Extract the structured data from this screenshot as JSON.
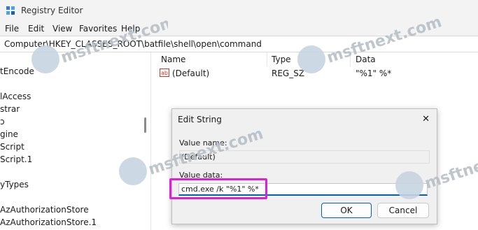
{
  "window": {
    "title": "Registry Editor"
  },
  "menu": [
    "File",
    "Edit",
    "View",
    "Favorites",
    "Help"
  ],
  "address": "Computer\\HKEY_CLASSES_ROOT\\batfile\\shell\\open\\command",
  "tree": {
    "items": [
      "tEncode",
      "lAccess",
      "strar",
      "ɔ",
      "gine",
      "Script",
      "Script.1",
      "yTypes",
      "AzAuthorizationStore",
      "AzAuthorizationStore.1"
    ]
  },
  "values": {
    "headers": {
      "name": "Name",
      "type": "Type",
      "data": "Data"
    },
    "rows": [
      {
        "name": "(Default)",
        "type": "REG_SZ",
        "data": "\"%1\" %*"
      }
    ]
  },
  "dialog": {
    "title": "Edit String",
    "close_glyph": "✕",
    "value_name_label": "Value name:",
    "value_name": "(Default)",
    "value_data_label": "Value data:",
    "value_data": "cmd.exe /k \"%1\" %*",
    "ok_label": "OK",
    "cancel_label": "Cancel"
  },
  "watermark": "msftnext.com",
  "colors": {
    "accent": "#005fb8",
    "highlight": "#e020d8"
  }
}
